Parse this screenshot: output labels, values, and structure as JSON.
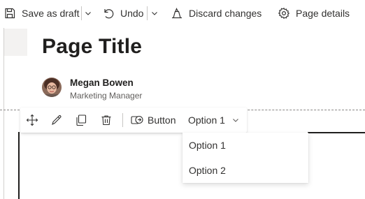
{
  "commandbar": {
    "save_draft": "Save as draft",
    "undo": "Undo",
    "discard": "Discard changes",
    "page_details": "Page details"
  },
  "page": {
    "title": "Page Title",
    "author": {
      "name": "Megan Bowen",
      "role": "Marketing Manager"
    }
  },
  "webpart_toolbar": {
    "button_label": "Button",
    "dropdown_value": "Option 1"
  },
  "dropdown_menu": {
    "options": [
      "Option 1",
      "Option 2"
    ]
  },
  "icons": {
    "save": "save-icon",
    "undo": "undo-icon",
    "discard": "discard-icon",
    "settings": "gear-icon",
    "move": "move-icon",
    "edit": "edit-pencil-icon",
    "duplicate": "duplicate-icon",
    "delete": "trash-icon",
    "button": "flow-button-icon",
    "chevron": "chevron-down-icon"
  }
}
